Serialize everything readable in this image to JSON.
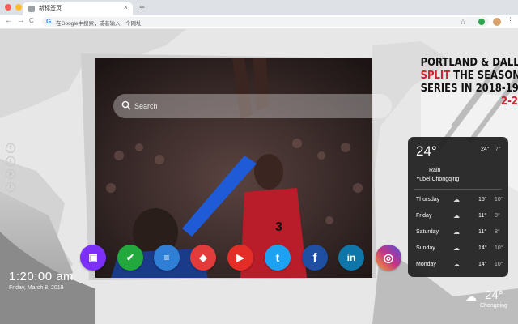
{
  "browser": {
    "tab_title": "新标签页",
    "tab_close": "×",
    "new_tab": "+",
    "omnibox_placeholder": "在Google中搜索，或者输入一个网址",
    "star": "☆",
    "menu": "⋮",
    "back": "←",
    "forward": "→",
    "reload": "C"
  },
  "search": {
    "placeholder": "Search"
  },
  "headline": {
    "line1": "PORTLAND & DALLAS",
    "line2_red": "SPLIT",
    "line2_rest": " THE SEASON",
    "line3": "SERIES IN 2018-19",
    "line4_red": "2-2"
  },
  "social_side": [
    {
      "icon": "facebook-icon",
      "glyph": "f"
    },
    {
      "icon": "twitter-icon",
      "glyph": "t"
    },
    {
      "icon": "pinterest-icon",
      "glyph": "p"
    },
    {
      "icon": "reddit-icon",
      "glyph": "r"
    }
  ],
  "weather": {
    "temp": "24°",
    "hi": "24°",
    "lo": "7°",
    "condition": "Rain",
    "location": "Yubei,Chongqing",
    "forecast": [
      {
        "day": "Thursday",
        "high": "15°",
        "low": "10°"
      },
      {
        "day": "Friday",
        "high": "11°",
        "low": "8°"
      },
      {
        "day": "Saturday",
        "high": "11°",
        "low": "8°"
      },
      {
        "day": "Sunday",
        "high": "14°",
        "low": "10°"
      },
      {
        "day": "Monday",
        "high": "14°",
        "low": "10°"
      }
    ]
  },
  "dock": [
    {
      "name": "photo-editor-app",
      "color": "#7b2ff7",
      "glyph": "▣"
    },
    {
      "name": "tasks-app",
      "color": "#22a83c",
      "glyph": "✔"
    },
    {
      "name": "notes-app",
      "color": "#2f7fd6",
      "glyph": "≡"
    },
    {
      "name": "games-app",
      "color": "#e23b3b",
      "glyph": "◆"
    },
    {
      "name": "youtube-app",
      "color": "#e52d27",
      "glyph": "▶"
    },
    {
      "name": "twitter-app",
      "color": "#1da1f2",
      "glyph": "t"
    },
    {
      "name": "facebook-app",
      "color": "#1e4fa3",
      "glyph": "f"
    },
    {
      "name": "linkedin-app",
      "color": "#0e76a8",
      "glyph": "in"
    },
    {
      "name": "instagram-app",
      "color": "#c13584",
      "glyph": "◎"
    }
  ],
  "clock": {
    "time": "1:20:00 am",
    "date": "Friday, March 8, 2019"
  },
  "corner_weather": {
    "temp": "24°",
    "location": "Chongqing"
  },
  "colors": {
    "accent_red": "#d1202f",
    "card_bg": "#1e1e1e"
  }
}
